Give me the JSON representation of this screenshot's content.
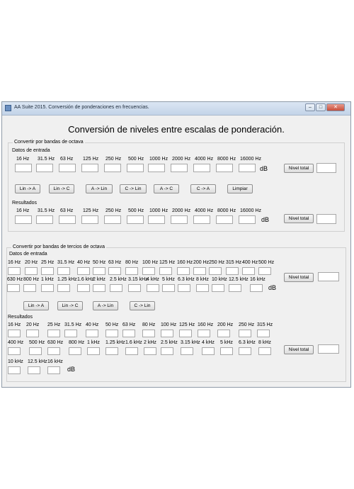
{
  "window": {
    "title": "AA Suite 2015. Conversión de ponderaciones en frecuencias."
  },
  "main": {
    "heading": "Conversión de niveles entre escalas de ponderación."
  },
  "octave": {
    "group_label": "Convertir por bandas de octava",
    "input_label": "Datos de entrada",
    "result_label": "Resultados",
    "bands": [
      "16 Hz",
      "31.5 Hz",
      "63 Hz",
      "125 Hz",
      "250 Hz",
      "500 Hz",
      "1000 Hz",
      "2000 Hz",
      "4000 Hz",
      "8000 Hz",
      "16000 Hz"
    ],
    "unit": "dB",
    "total_label": "Nivel total",
    "buttons": [
      "Lin -> A",
      "Lin -> C",
      "A -> Lin",
      "C -> Lin",
      "A -> C",
      "C -> A",
      "Limpiar"
    ]
  },
  "third": {
    "group_label": "Convertir por bandas de tercios de octava",
    "input_label": "Datos de entrada",
    "result_label": "Resultados",
    "bands_row1": [
      "16 Hz",
      "20 Hz",
      "25 Hz",
      "31.5 Hz",
      "40 Hz",
      "50 Hz",
      "63 Hz",
      "80 Hz",
      "100 Hz",
      "125 Hz",
      "160 Hz",
      "200 Hz",
      "250 Hz",
      "315 Hz",
      "400 Hz",
      "500 Hz"
    ],
    "bands_row2": [
      "630 Hz",
      "800 Hz",
      "1 kHz",
      "1.25 kHz",
      "1.6 kHz",
      "2 kHz",
      "2.5 kHz",
      "3.15 kHz",
      "4 kHz",
      "5 kHz",
      "6.3 kHz",
      "8 kHz",
      "10 kHz",
      "12.5 kHz",
      "16 kHz"
    ],
    "res_row1": [
      "16 Hz",
      "20 Hz",
      "25 Hz",
      "31.5 Hz",
      "40 Hz",
      "50 Hz",
      "63 Hz",
      "80 Hz",
      "100 Hz",
      "125 Hz",
      "160 Hz",
      "200 Hz",
      "250 Hz",
      "315 Hz"
    ],
    "res_row2": [
      "400 Hz",
      "500 Hz",
      "630 Hz",
      "800 Hz",
      "1 kHz",
      "1.25 kHz",
      "1.6 kHz",
      "2 kHz",
      "2.5 kHz",
      "3.15 kHz",
      "4 kHz",
      "5 kHz",
      "6.3 kHz",
      "8 kHz"
    ],
    "res_row3": [
      "10 kHz",
      "12.5 kHz",
      "16 kHz"
    ],
    "unit": "dB",
    "total_label": "Nivel total",
    "buttons": [
      "Lin -> A",
      "Lin -> C",
      "A -> Lin",
      "C -> Lin"
    ]
  }
}
